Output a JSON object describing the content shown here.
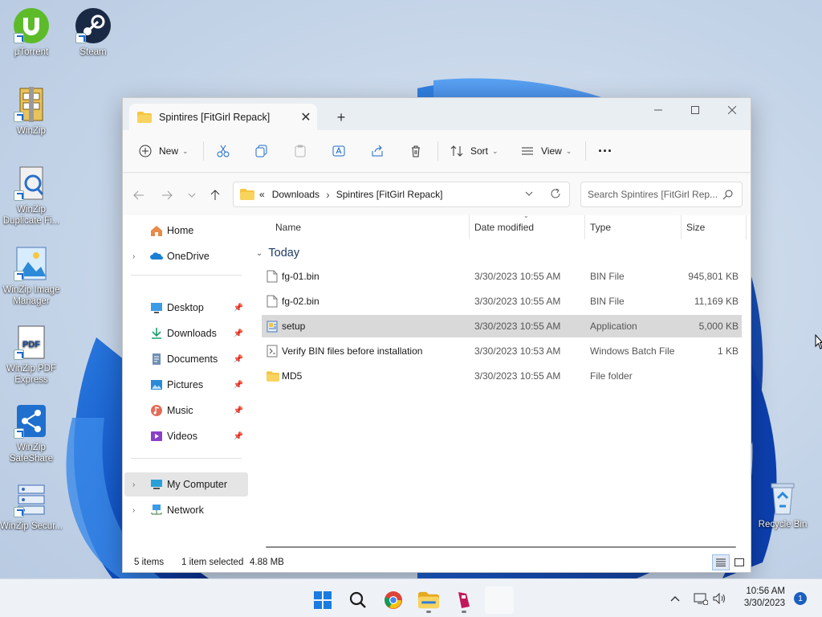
{
  "desktop": {
    "icons": [
      {
        "label": "μTorrent"
      },
      {
        "label": "Steam"
      },
      {
        "label": "WinZip"
      },
      {
        "label": "WinZip Duplicate Fi..."
      },
      {
        "label": "WinZip Image Manager"
      },
      {
        "label": "WinZip PDF Express"
      },
      {
        "label": "WinZip SafeShare"
      },
      {
        "label": "WinZip Secur..."
      },
      {
        "label": "Recycle Bin"
      }
    ]
  },
  "window": {
    "tab_title": "Spintires [FitGirl Repack]",
    "new_tab_symbol": "+",
    "close_tab_symbol": "✕"
  },
  "toolbar": {
    "new_label": "New",
    "sort_label": "Sort",
    "view_label": "View",
    "more_label": "···"
  },
  "address": {
    "prefix": "«",
    "crumbs": [
      "Downloads",
      "Spintires [FitGirl Repack]"
    ]
  },
  "search": {
    "placeholder": "Search Spintires [FitGirl Rep..."
  },
  "sidebar": {
    "items": [
      {
        "label": "Home",
        "icon": "home-icon"
      },
      {
        "label": "OneDrive",
        "icon": "cloud-icon"
      },
      {
        "label": "Desktop",
        "icon": "desktop-icon"
      },
      {
        "label": "Downloads",
        "icon": "download-icon"
      },
      {
        "label": "Documents",
        "icon": "document-icon"
      },
      {
        "label": "Pictures",
        "icon": "picture-icon"
      },
      {
        "label": "Music",
        "icon": "music-icon"
      },
      {
        "label": "Videos",
        "icon": "video-icon"
      },
      {
        "label": "My Computer",
        "icon": "computer-icon"
      },
      {
        "label": "Network",
        "icon": "network-icon"
      }
    ]
  },
  "filelist": {
    "columns": [
      "Name",
      "Date modified",
      "Type",
      "Size"
    ],
    "group": "Today",
    "rows": [
      {
        "name": "fg-01.bin",
        "date": "3/30/2023 10:55 AM",
        "type": "BIN File",
        "size": "945,801 KB"
      },
      {
        "name": "fg-02.bin",
        "date": "3/30/2023 10:55 AM",
        "type": "BIN File",
        "size": "11,169 KB"
      },
      {
        "name": "setup",
        "date": "3/30/2023 10:55 AM",
        "type": "Application",
        "size": "5,000 KB"
      },
      {
        "name": "Verify BIN files before installation",
        "date": "3/30/2023 10:53 AM",
        "type": "Windows Batch File",
        "size": "1 KB"
      },
      {
        "name": "MD5",
        "date": "3/30/2023 10:55 AM",
        "type": "File folder",
        "size": ""
      }
    ]
  },
  "status": {
    "items": "5 items",
    "selected": "1 item selected",
    "size": "4.88 MB"
  },
  "taskbar": {
    "time": "10:56 AM",
    "date": "3/30/2023",
    "notifications": "1"
  },
  "colors": {
    "accent": "#1b5fbf",
    "folder": "#f5c542",
    "selection": "#d9d9d9"
  }
}
